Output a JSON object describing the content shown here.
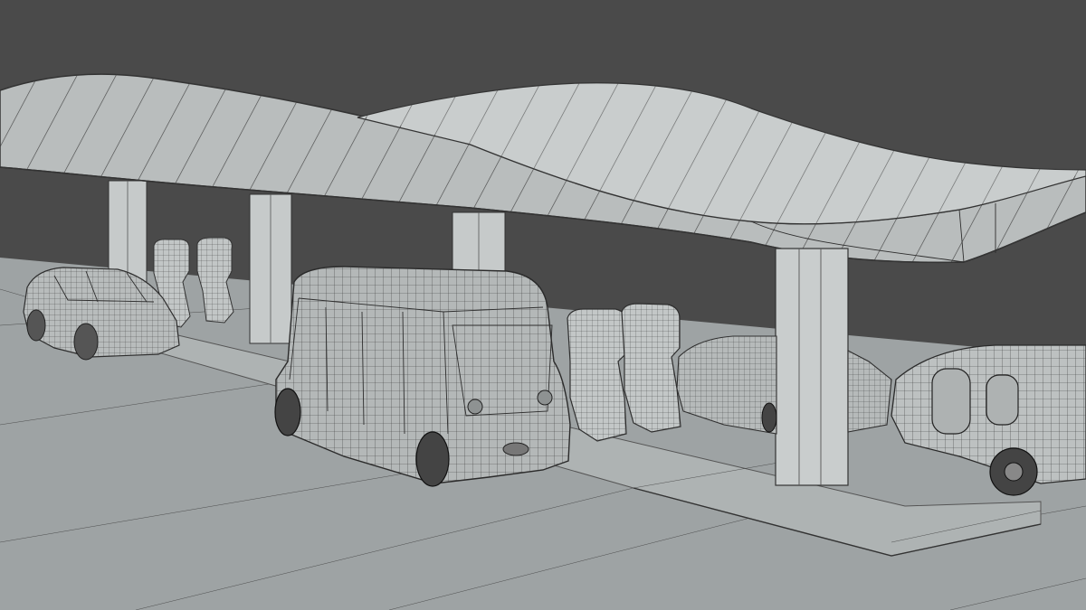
{
  "viewport": {
    "background_color": "#4a4a4a",
    "ground_color": "#9ea3a4",
    "canopy_color": "#b9bdbd",
    "wire_color": "#2e2e2e",
    "shading": "wireframe-on-shaded"
  },
  "scene": {
    "objects": [
      {
        "name": "canopy-roof",
        "icon": "canopy-icon"
      },
      {
        "name": "support-column",
        "count": 4
      },
      {
        "name": "charging-station",
        "count": 4
      },
      {
        "name": "suv-car"
      },
      {
        "name": "autonomous-shuttle"
      },
      {
        "name": "sedan-car"
      },
      {
        "name": "teardrop-trailer"
      },
      {
        "name": "curb-platform"
      }
    ]
  }
}
